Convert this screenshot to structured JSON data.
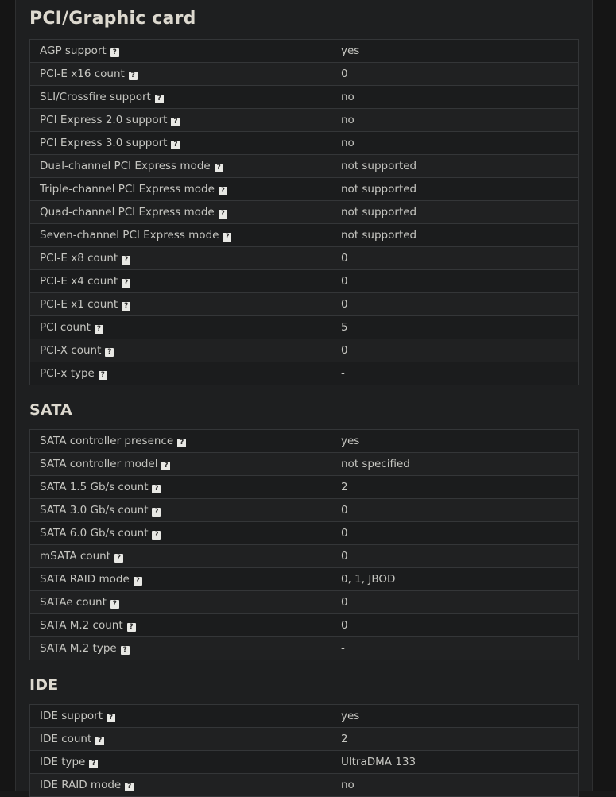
{
  "help_badge_glyph": "?",
  "colors": {
    "page_background": "#151515",
    "content_background": "#1e1f20",
    "row_odd": "#1b1c1d",
    "row_even": "#202122",
    "border": "#343638",
    "text": "#c6c6c1",
    "heading_text": "#ddd9cf",
    "badge_background": "#e8e8e4",
    "badge_text": "#2a2a2a"
  },
  "sections": [
    {
      "title": "PCI/Graphic card",
      "rows": [
        {
          "label": "AGP support",
          "value": "yes"
        },
        {
          "label": "PCI-E x16 count",
          "value": "0"
        },
        {
          "label": "SLI/Crossfire support",
          "value": "no"
        },
        {
          "label": "PCI Express 2.0 support",
          "value": "no"
        },
        {
          "label": "PCI Express 3.0 support",
          "value": "no"
        },
        {
          "label": "Dual-channel PCI Express mode",
          "value": "not supported"
        },
        {
          "label": "Triple-channel PCI Express mode",
          "value": "not supported"
        },
        {
          "label": "Quad-channel PCI Express mode",
          "value": "not supported"
        },
        {
          "label": "Seven-channel PCI Express mode",
          "value": "not supported"
        },
        {
          "label": "PCI-E x8 count",
          "value": "0"
        },
        {
          "label": "PCI-E x4 count",
          "value": "0"
        },
        {
          "label": "PCI-E x1 count",
          "value": "0"
        },
        {
          "label": "PCI count",
          "value": "5"
        },
        {
          "label": "PCI-X count",
          "value": "0"
        },
        {
          "label": "PCI-x type",
          "value": "-"
        }
      ]
    },
    {
      "title": "SATA",
      "rows": [
        {
          "label": "SATA controller presence",
          "value": "yes"
        },
        {
          "label": "SATA controller model",
          "value": "not specified"
        },
        {
          "label": "SATA 1.5 Gb/s count",
          "value": "2"
        },
        {
          "label": "SATA 3.0 Gb/s count",
          "value": "0"
        },
        {
          "label": "SATA 6.0 Gb/s count",
          "value": "0"
        },
        {
          "label": "mSATA count",
          "value": "0"
        },
        {
          "label": "SATA RAID mode",
          "value": "0, 1, JBOD"
        },
        {
          "label": "SATAe count",
          "value": "0"
        },
        {
          "label": "SATA M.2 count",
          "value": "0"
        },
        {
          "label": "SATA M.2 type",
          "value": "-"
        }
      ]
    },
    {
      "title": "IDE",
      "rows": [
        {
          "label": "IDE support",
          "value": "yes"
        },
        {
          "label": "IDE count",
          "value": "2"
        },
        {
          "label": "IDE type",
          "value": "UltraDMA 133"
        },
        {
          "label": "IDE RAID mode",
          "value": "no"
        }
      ]
    }
  ]
}
